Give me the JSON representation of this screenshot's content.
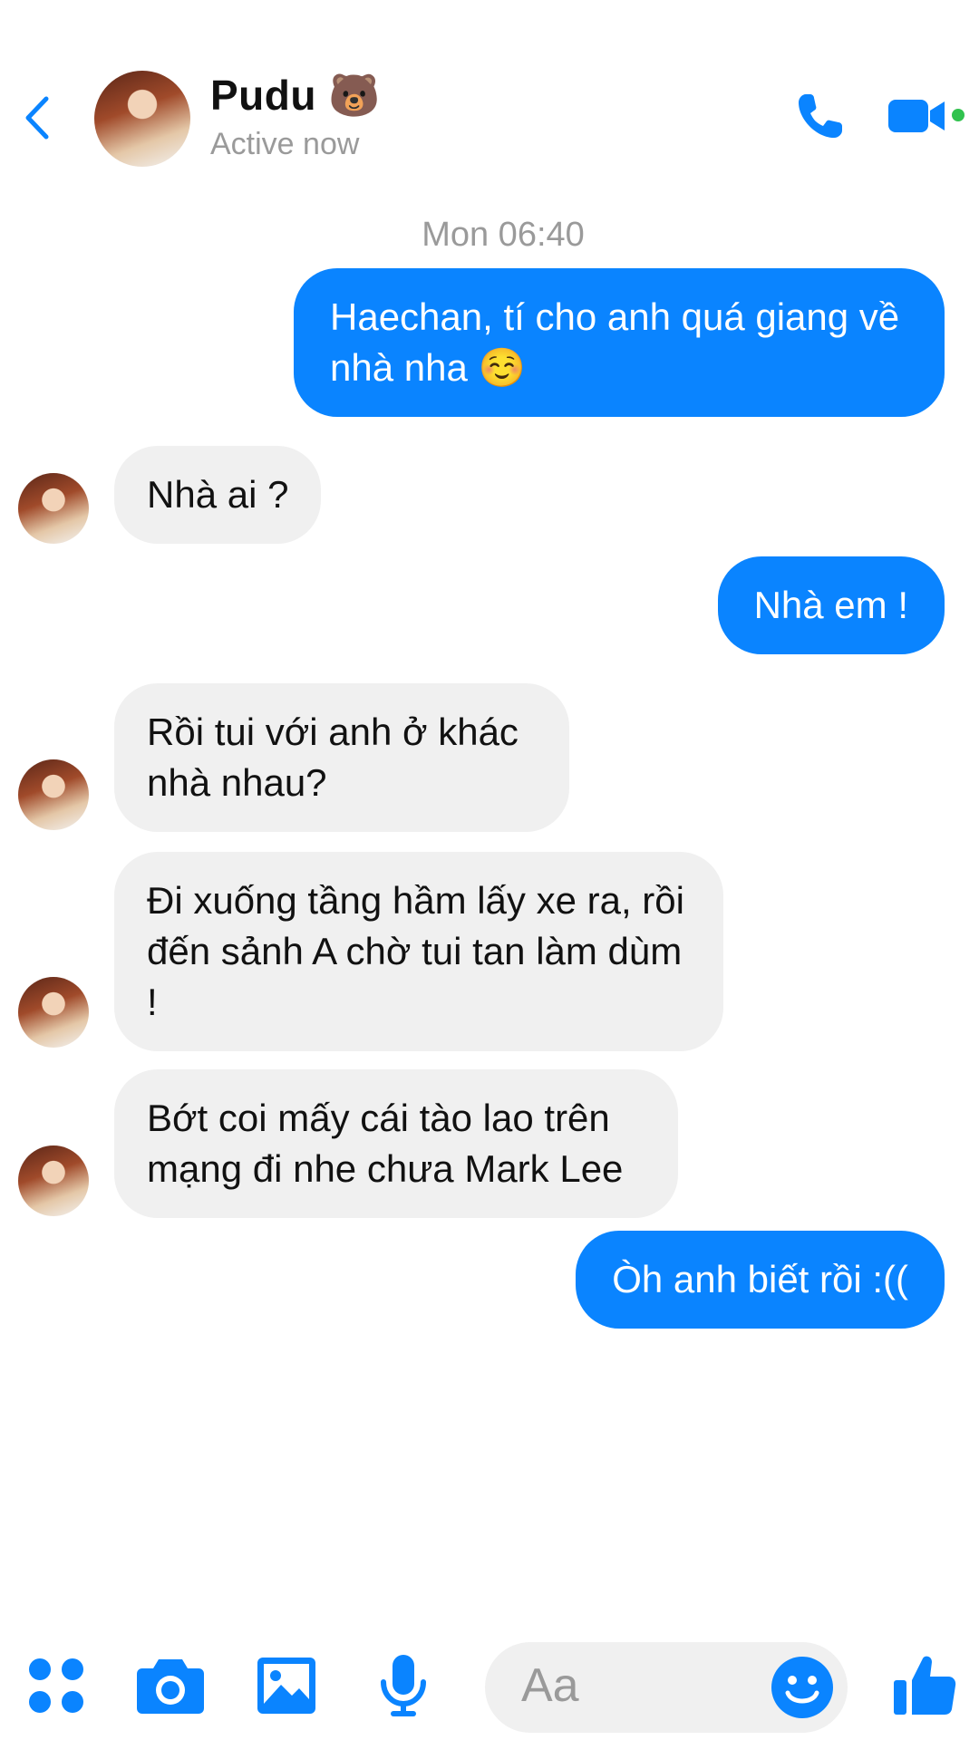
{
  "header": {
    "contact_name": "Pudu 🐻",
    "status": "Active now"
  },
  "conversation": {
    "timestamp": "Mon 06:40",
    "messages": [
      {
        "from": "me",
        "text": "Haechan, tí cho anh quá giang về nhà nha ☺️"
      },
      {
        "from": "contact",
        "text": "Nhà ai ?"
      },
      {
        "from": "me",
        "text": "Nhà em !"
      },
      {
        "from": "contact",
        "text": "Rồi tui với anh ở khác nhà nhau?"
      },
      {
        "from": "contact",
        "text": "Đi xuống tầng hầm lấy xe ra, rồi đến sảnh A chờ tui tan làm dùm !"
      },
      {
        "from": "contact",
        "text": "Bớt coi mấy cái tào lao trên mạng đi nhe chưa Mark Lee"
      },
      {
        "from": "me",
        "text": "Òh anh biết rồi :(("
      }
    ]
  },
  "composer": {
    "placeholder": "Aa"
  },
  "icons": {
    "back": "chevron-left-icon",
    "call": "phone-icon",
    "video": "video-camera-icon",
    "apps": "four-dots-icon",
    "camera": "camera-icon",
    "gallery": "image-icon",
    "voice": "microphone-icon",
    "emoji": "smiley-icon",
    "like": "thumbs-up-icon"
  },
  "colors": {
    "accent": "#0a84ff",
    "bubble_received": "#f0f0f0",
    "online": "#31c24e"
  }
}
